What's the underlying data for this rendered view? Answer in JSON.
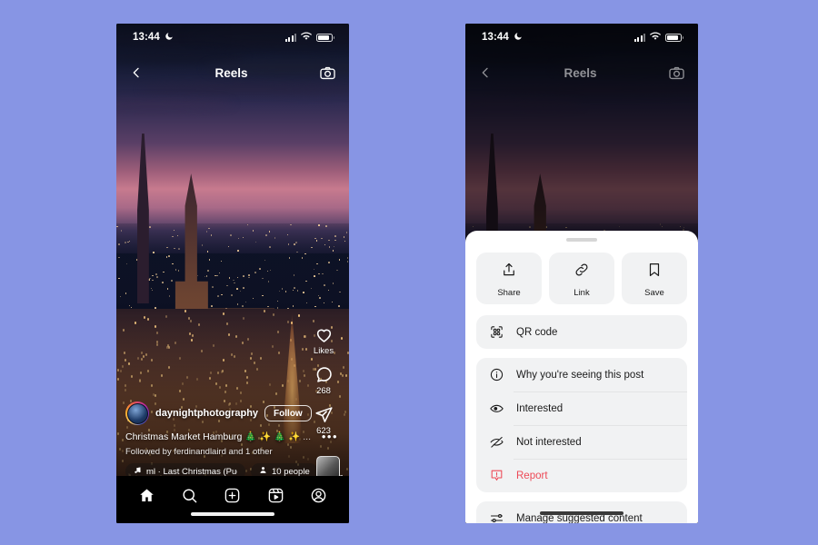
{
  "background_color": "#8795e4",
  "status_bar": {
    "time": "13:44",
    "moon_icon": "crescent-moon-icon",
    "signal_icon": "cellular-signal-icon",
    "wifi_icon": "wifi-icon",
    "battery_icon": "battery-icon"
  },
  "header": {
    "back_icon": "chevron-left-icon",
    "title": "Reels",
    "camera_icon": "camera-icon"
  },
  "reel": {
    "username": "daynightphotography",
    "follow_label": "Follow",
    "caption": "Christmas Market Hamburg 🎄 ✨ 🎄 ✨",
    "caption_more": "...",
    "followed_by": "Followed by ferdinandlaird and 1 other",
    "music_text": "ml · Last Christmas (Puddin",
    "music_icon": "music-note-icon",
    "people_count": "10 people",
    "people_icon": "person-icon",
    "album_art_icon": "album-art-thumbnail",
    "more_options_icon": "ellipsis-icon",
    "actions": [
      {
        "icon": "heart-icon",
        "label": "Likes",
        "name": "like-button"
      },
      {
        "icon": "comment-icon",
        "label": "268",
        "name": "comment-button"
      },
      {
        "icon": "share-icon",
        "label": "623",
        "name": "share-button"
      }
    ]
  },
  "tabbar": {
    "items": [
      {
        "icon": "home-icon",
        "name": "tab-home"
      },
      {
        "icon": "search-icon",
        "name": "tab-search"
      },
      {
        "icon": "create-icon",
        "name": "tab-create"
      },
      {
        "icon": "reels-icon",
        "name": "tab-reels"
      },
      {
        "icon": "profile-icon",
        "name": "tab-profile"
      }
    ]
  },
  "sheet": {
    "grabber": "drag-handle",
    "quick_actions": [
      {
        "label": "Share",
        "icon": "share-upload-icon",
        "name": "share-tile"
      },
      {
        "label": "Link",
        "icon": "link-icon",
        "name": "link-tile"
      },
      {
        "label": "Save",
        "icon": "bookmark-icon",
        "name": "save-tile"
      }
    ],
    "groups": [
      {
        "rows": [
          {
            "label": "QR code",
            "icon": "qr-code-icon",
            "name": "qr-code-row",
            "danger": false
          }
        ]
      },
      {
        "rows": [
          {
            "label": "Why you're seeing this post",
            "icon": "info-circle-icon",
            "name": "why-seeing-row",
            "danger": false
          },
          {
            "label": "Interested",
            "icon": "eye-icon",
            "name": "interested-row",
            "danger": false
          },
          {
            "label": "Not interested",
            "icon": "eye-off-icon",
            "name": "not-interested-row",
            "danger": false
          },
          {
            "label": "Report",
            "icon": "report-warning-icon",
            "name": "report-row",
            "danger": true
          }
        ]
      },
      {
        "rows": [
          {
            "label": "Manage suggested content",
            "icon": "sliders-icon",
            "name": "manage-suggested-row",
            "danger": false
          }
        ]
      }
    ],
    "report_color": "#ed4956"
  }
}
